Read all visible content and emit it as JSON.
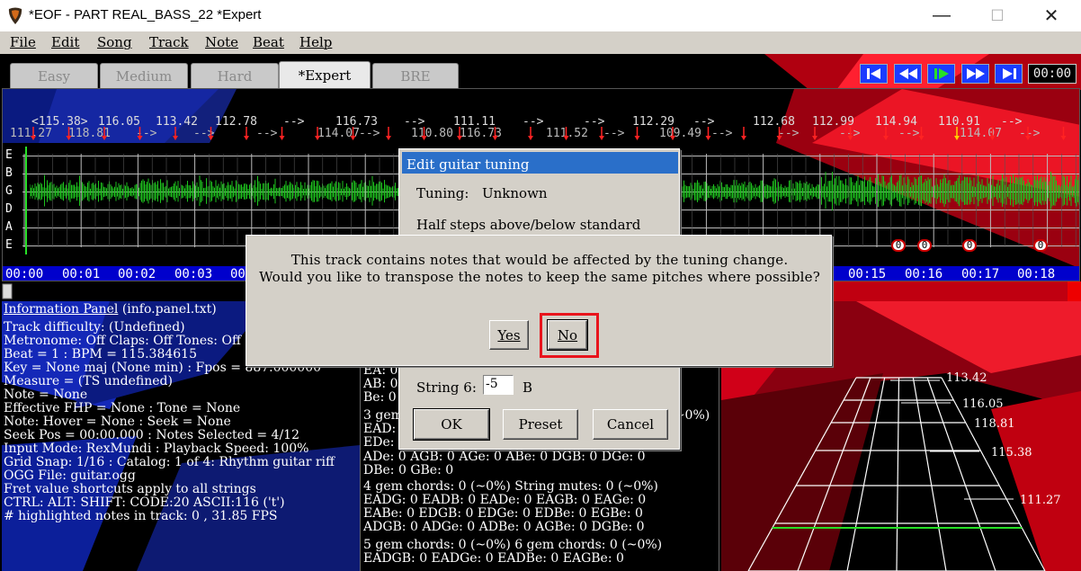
{
  "window": {
    "title": "*EOF - PART REAL_BASS_22  *Expert",
    "minimize_glyph": "—",
    "maximize_glyph": "☐",
    "close_glyph": "✕"
  },
  "menu": [
    "File",
    "Edit",
    "Song",
    "Track",
    "Note",
    "Beat",
    "Help"
  ],
  "tabs": [
    "Easy",
    "Medium",
    "Hard",
    "*Expert",
    "BRE"
  ],
  "active_tab": "*Expert",
  "transport": {
    "buttons": [
      "seek-start-icon",
      "rewind-icon",
      "play-icon",
      "fast-forward-icon",
      "seek-end-icon"
    ],
    "counter": "00:00"
  },
  "editor": {
    "bpm_top": [
      "<115.38>",
      "116.05",
      "113.42",
      "112.78",
      "-->",
      "116.73",
      "-->",
      "111.11",
      "-->",
      "-->",
      "112.29",
      "-->",
      "112.68",
      "112.99",
      "114.94",
      "110.91",
      "-->"
    ],
    "bpm_bottom": [
      "111.27",
      "118.81",
      "-->",
      "-->",
      "-->",
      "114.07",
      "-->",
      "110.80",
      "116.73",
      "111.52",
      "-->",
      "109.49",
      "-->",
      "-->",
      "-->",
      "-->",
      "114.07",
      "-->"
    ],
    "strings": [
      "E",
      "B",
      "G",
      "D",
      "A",
      "E"
    ],
    "timeline": [
      "00:00",
      "00:01",
      "00:02",
      "00:03",
      "00:04",
      "00:15",
      "00:16",
      "00:17",
      "00:18"
    ],
    "fret_notes": [
      "0",
      "0",
      "0",
      "0"
    ]
  },
  "info_panel": {
    "heading": "Information Panel",
    "heading_file": " (info.panel.txt)",
    "lines": [
      "Track difficulty: (Undefined)",
      "Metronome: Off Claps: Off Tones: Off",
      "Beat = 1 : BPM = 115.384615",
      "Key = None maj (None min) : Fpos = 887.000000",
      "Measure = (TS undefined)",
      "Note = None",
      "Effective FHP = None : Tone = None",
      "Note: Hover = None : Seek = None",
      "Seek Pos = 00:00.000 : Notes Selected = 4/12",
      "Input Mode: RexMundi : Playback Speed: 100%",
      "Grid Snap: 1/16 : Catalog: 1 of 4: Rhythm guitar riff",
      "OGG File: guitar.ogg",
      "Fret value shortcuts apply to all strings",
      "CTRL:   ALT:   SHIFT:   CODE:20  ASCII:116 ('t')",
      "# highlighted notes in track: 0 , 31.85 FPS"
    ]
  },
  "chord_panel": {
    "lines": [
      "EA:  0",
      "AB:  0",
      "Be:  0",
      "3 gem chords: 0 (~0%)",
      "EAD: 0",
      "EDe: 0",
      "ADe:  0  AGB:  0  AGe:  0  ABe:  0  DGB:  0  DGe:  0",
      "DBe:  0  GBe:  0",
      "4 gem chords: 0 (~0%)     String mutes: 0 (~0%)",
      "EADG: 0  EADB: 0  EADe: 0  EAGB: 0  EAGe: 0",
      "EABe: 0  EDGB: 0  EDGe: 0  EDBe: 0  EGBe: 0",
      "ADGB: 0  ADGe: 0  ADBe: 0  AGBe: 0  DGBe: 0",
      "5 gem chords: 0 (~0%)     6 gem chords: 0 (~0%)",
      "EADGB: 0  EADGe: 0  EADBe: 0  EAGBe: 0"
    ],
    "partial_right": "0 (~0%)"
  },
  "view3d": {
    "bpm_labels": [
      "113.42",
      "116.05",
      "118.81",
      "115.38",
      "111.27"
    ]
  },
  "tuning_dialog": {
    "title": "Edit guitar tuning",
    "tuning_label": "Tuning:",
    "tuning_value": "Unknown",
    "half_steps_label": "Half steps above/below standard",
    "string6_label": "String 6:",
    "string6_value": "-5",
    "string6_note": "B",
    "ok": "OK",
    "preset": "Preset",
    "cancel": "Cancel"
  },
  "confirm_dialog": {
    "line1": "This track contains notes that would be affected by the tuning change.",
    "line2": "Would you like to transpose the notes to keep the same pitches where possible?",
    "yes": "Yes",
    "no": "No",
    "highlight_color": "#e8141c"
  },
  "colors": {
    "waveform": "#1ec21e",
    "timeline": "#0000cc",
    "marker": "#ff2222",
    "dialog_title": "#2a6fc9"
  }
}
